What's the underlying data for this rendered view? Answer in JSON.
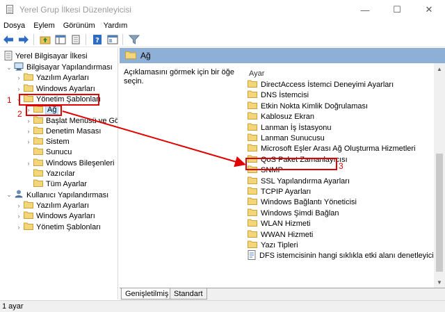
{
  "window": {
    "title": "Yerel Grup İlkesi Düzenleyicisi",
    "minimize": "—",
    "maximize": "☐",
    "close": "✕"
  },
  "menu": [
    "Dosya",
    "Eylem",
    "Görünüm",
    "Yardım"
  ],
  "tree": {
    "root": "Yerel Bilgisayar İlkesi",
    "items": [
      {
        "label": "Bilgisayar Yapılandırması"
      },
      {
        "label": "Yazılım Ayarları"
      },
      {
        "label": "Windows Ayarları"
      },
      {
        "label": "Yönetim Şablonları"
      },
      {
        "label": "Ağ"
      },
      {
        "label": "Başlat Menüsü ve Görev Çubuğu"
      },
      {
        "label": "Denetim Masası"
      },
      {
        "label": "Sistem"
      },
      {
        "label": "Sunucu"
      },
      {
        "label": "Windows Bileşenleri"
      },
      {
        "label": "Yazıcılar"
      },
      {
        "label": "Tüm Ayarlar"
      },
      {
        "label": "Kullanıcı Yapılandırması"
      },
      {
        "label": "Yazılım Ayarları"
      },
      {
        "label": "Windows Ayarları"
      },
      {
        "label": "Yönetim Şablonları"
      }
    ]
  },
  "right": {
    "header": "Ağ",
    "description": "Açıklamasını görmek için bir öğe seçin.",
    "column": "Ayar",
    "items": [
      "DirectAccess İstemci Deneyimi Ayarları",
      "DNS İstemcisi",
      "Etkin Nokta Kimlik Doğrulaması",
      "Kablosuz Ekran",
      "Lanman İş İstasyonu",
      "Lanman Sunucusu",
      "Microsoft Eşler Arası Ağ Oluşturma Hizmetleri",
      "QoS Paket Zamanlayıcısı",
      "SNMP",
      "SSL Yapılandırma Ayarları",
      "TCPIP Ayarları",
      "Windows Bağlantı Yöneticisi",
      "Windows Şimdi Bağlan",
      "WLAN Hizmeti",
      "WWAN Hizmeti",
      "Yazı Tipleri",
      "DFS istemcisinin hangi sıklıkla etki alanı denetleyicilerini k"
    ]
  },
  "tabs": [
    "Genişletilmiş",
    "Standart"
  ],
  "status": "1 ayar",
  "annotations": [
    "1",
    "2",
    "3"
  ],
  "colors": {
    "header": "#8fb0d6",
    "annotation": "#e00000",
    "folder": "#e8c25a",
    "selection": "#cce8ff"
  }
}
